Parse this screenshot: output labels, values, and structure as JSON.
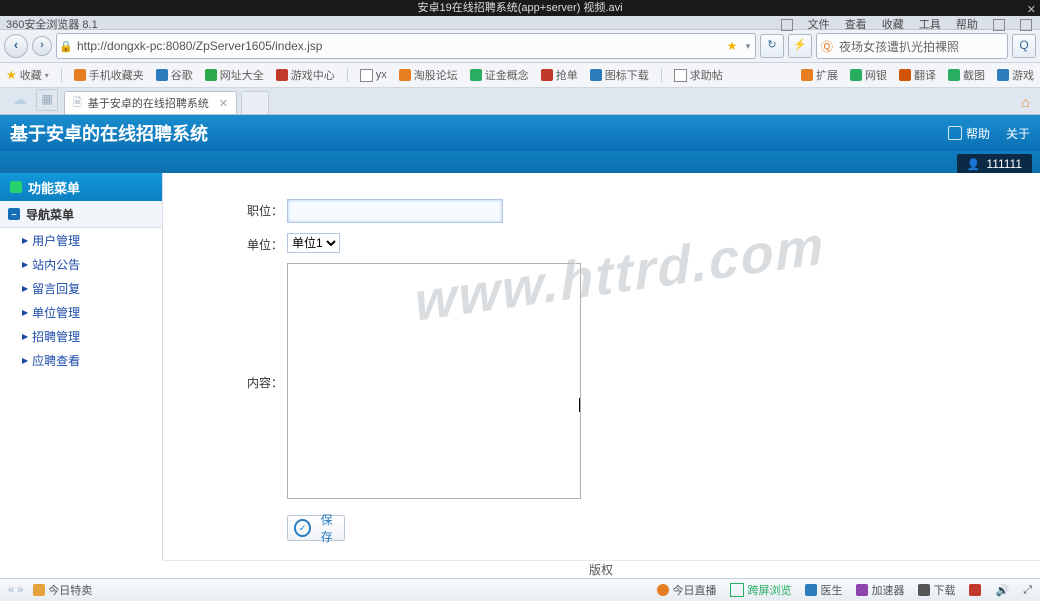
{
  "window": {
    "title": "安卓19在线招聘系统(app+server) 视频.avi"
  },
  "browserTop": {
    "brand": "360安全浏览器 8.1",
    "menu": [
      "文件",
      "查看",
      "收藏",
      "工具",
      "帮助"
    ]
  },
  "addressBar": {
    "url": "http://dongxk-pc:8080/ZpServer1605/index.jsp",
    "searchPlaceholder": "夜场女孩遭扒光拍裸照"
  },
  "bookmarks": {
    "favLabel": "收藏",
    "left": [
      {
        "label": "手机收藏夹",
        "color": "#e67e22"
      },
      {
        "label": "谷歌",
        "color": "#2b7bbd"
      },
      {
        "label": "网址大全",
        "color": "#2aa84a"
      },
      {
        "label": "游戏中心",
        "color": "#c0392b"
      },
      {
        "label": "yx",
        "color": "#888"
      },
      {
        "label": "淘股论坛",
        "color": "#e67e22"
      },
      {
        "label": "证金概念",
        "color": "#27ae60"
      },
      {
        "label": "抢单",
        "color": "#c0392b"
      },
      {
        "label": "图标下载",
        "color": "#2b7bbd"
      },
      {
        "label": "求助帖",
        "color": "#555"
      }
    ],
    "right": [
      {
        "label": "扩展",
        "color": "#e67e22"
      },
      {
        "label": "网银",
        "color": "#27ae60"
      },
      {
        "label": "翻译",
        "color": "#d35400"
      },
      {
        "label": "截图",
        "color": "#27ae60"
      },
      {
        "label": "游戏",
        "color": "#2b7bbd"
      }
    ]
  },
  "tab": {
    "title": "基于安卓的在线招聘系统"
  },
  "appHeader": {
    "title": "基于安卓的在线招聘系统",
    "links": [
      "帮助",
      "关于"
    ]
  },
  "user": {
    "name": "111111"
  },
  "sidebar": {
    "title": "功能菜单",
    "group": "导航菜单",
    "items": [
      "用户管理",
      "站内公告",
      "留言回复",
      "单位管理",
      "招聘管理",
      "应聘查看"
    ]
  },
  "form": {
    "position_label": "职位：",
    "position_value": "",
    "unit_label": "单位：",
    "unit_options": [
      "单位1"
    ],
    "unit_selected": "单位1",
    "content_label": "内容：",
    "content_value": "",
    "save_label": "保存"
  },
  "watermark": "www.httrd.com",
  "footer": {
    "copyright": "版权"
  },
  "statusBar": {
    "left": [
      "今日特卖"
    ],
    "right": [
      {
        "label": "今日直播",
        "color": "#e67e22"
      },
      {
        "label": "跨屏浏览",
        "color": "#27ae60"
      },
      {
        "label": "医生",
        "color": "#2b7bbd"
      },
      {
        "label": "加速器",
        "color": "#8e44ad"
      },
      {
        "label": "下载",
        "color": "#555"
      },
      {
        "label": "",
        "color": "#555"
      }
    ]
  },
  "urlBold": "dongxk-pc"
}
